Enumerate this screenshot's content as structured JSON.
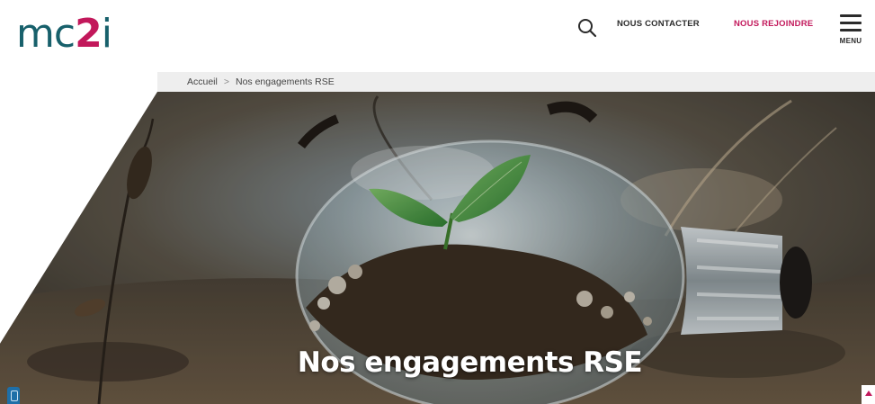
{
  "header": {
    "logo": {
      "part1": "mc",
      "part2": "2",
      "part3": "i"
    },
    "search_icon": "search-icon",
    "nav": {
      "contact_label": "NOUS CONTACTER",
      "join_label": "NOUS REJOINDRE"
    },
    "menu": {
      "icon": "hamburger-icon",
      "label": "MENU"
    }
  },
  "breadcrumb": {
    "home_label": "Accueil",
    "separator": ">",
    "current_label": "Nos engagements RSE"
  },
  "hero": {
    "title": "Nos engagements RSE",
    "image": "lightbulb-with-plant-photo"
  },
  "colors": {
    "brand_teal": "#17606b",
    "brand_pink": "#c2185b",
    "text_dark": "#2b2b2b",
    "breadcrumb_bg": "#eeeeee"
  }
}
